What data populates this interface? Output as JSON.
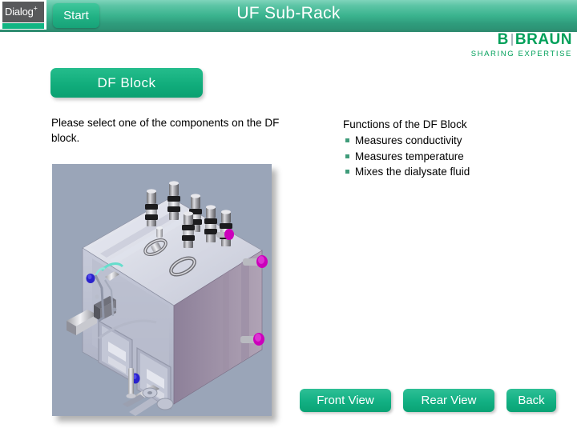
{
  "header": {
    "logo_text": "Dialog",
    "logo_superscript": "+",
    "start_label": "Start",
    "title": "UF Sub-Rack",
    "bar_color": "#2f9c7c"
  },
  "brand": {
    "name_first": "B",
    "name_rest": "BRAUN",
    "tagline": "SHARING EXPERTISE",
    "color": "#00a05a"
  },
  "content": {
    "section_title": "DF Block",
    "instruction": "Please select one of the components on the DF block."
  },
  "functions": {
    "title": "Functions of the DF Block",
    "bullet_color": "#3f9c7a",
    "items": [
      {
        "label": "Measures conductivity"
      },
      {
        "label": "Measures temperature"
      },
      {
        "label": "Mixes the dialysate fluid"
      }
    ]
  },
  "illustration": {
    "name": "df-block-3d-render",
    "background_color": "#9aa5b8",
    "hotspots": [
      {
        "name": "hotspot-magenta-top",
        "color": "#cc00bb"
      },
      {
        "name": "hotspot-magenta-mid",
        "color": "#cc00bb"
      },
      {
        "name": "hotspot-magenta-low",
        "color": "#cc00bb"
      },
      {
        "name": "hotspot-blue-upper",
        "color": "#2a22cc"
      },
      {
        "name": "hotspot-blue-lower",
        "color": "#2a22cc"
      },
      {
        "name": "hotspot-teal",
        "color": "#66ddcc"
      }
    ]
  },
  "footer": {
    "buttons": [
      {
        "label": "Front View",
        "name": "front-view-button"
      },
      {
        "label": "Rear View",
        "name": "rear-view-button"
      },
      {
        "label": "Back",
        "name": "back-button"
      }
    ]
  }
}
